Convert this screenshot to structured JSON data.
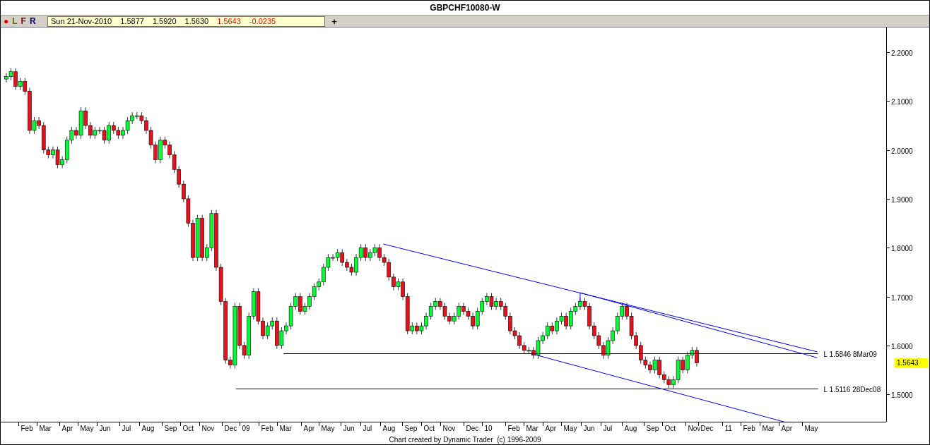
{
  "window": {
    "title": "GBPCHF10080-W"
  },
  "toolbar": {
    "buttons": [
      {
        "label": "●",
        "color": "#e00000"
      },
      {
        "label": "L",
        "color": "#6b6b00"
      },
      {
        "label": "F",
        "color": "#8b0000"
      },
      {
        "label": "R",
        "color": "#000080"
      }
    ],
    "info": [
      {
        "text": "Sun 21-Nov-2010",
        "kind": "date"
      },
      {
        "text": "1.5877",
        "kind": "value"
      },
      {
        "text": "1.5920",
        "kind": "value"
      },
      {
        "text": "1.5630",
        "kind": "value"
      },
      {
        "text": "1.5643",
        "kind": "change"
      },
      {
        "text": "-0.0235",
        "kind": "change"
      }
    ],
    "add_button": "+"
  },
  "chart": {
    "price_axis": [
      "2.2000",
      "2.1000",
      "2.0000",
      "1.9000",
      "1.8000",
      "1.7000",
      "1.6000",
      "1.5000"
    ],
    "time_axis": [
      "Feb",
      "Mar",
      "Apr",
      "May",
      "Jun",
      "Jul",
      "Aug",
      "Sep",
      "Oct",
      "Nov",
      "Dec",
      "09",
      "Feb",
      "Mar",
      "Apr",
      "May",
      "Jun",
      "Jul",
      "Aug",
      "Sep",
      "Oct",
      "Nov",
      "Dec",
      "10",
      "Feb",
      "Mar",
      "Apr",
      "May",
      "Jun",
      "Jul",
      "Aug",
      "Sep",
      "Oct",
      "Nov",
      "Dec",
      "11",
      "Feb",
      "Mar",
      "Apr",
      "May"
    ],
    "line_labels": [
      "L 1.5846 8Mar09",
      "L 1.5116 28Dec08"
    ],
    "last_price": "1.5643"
  },
  "footer": "Chart created by Dynamic Trader  (c) 1996-2009"
}
